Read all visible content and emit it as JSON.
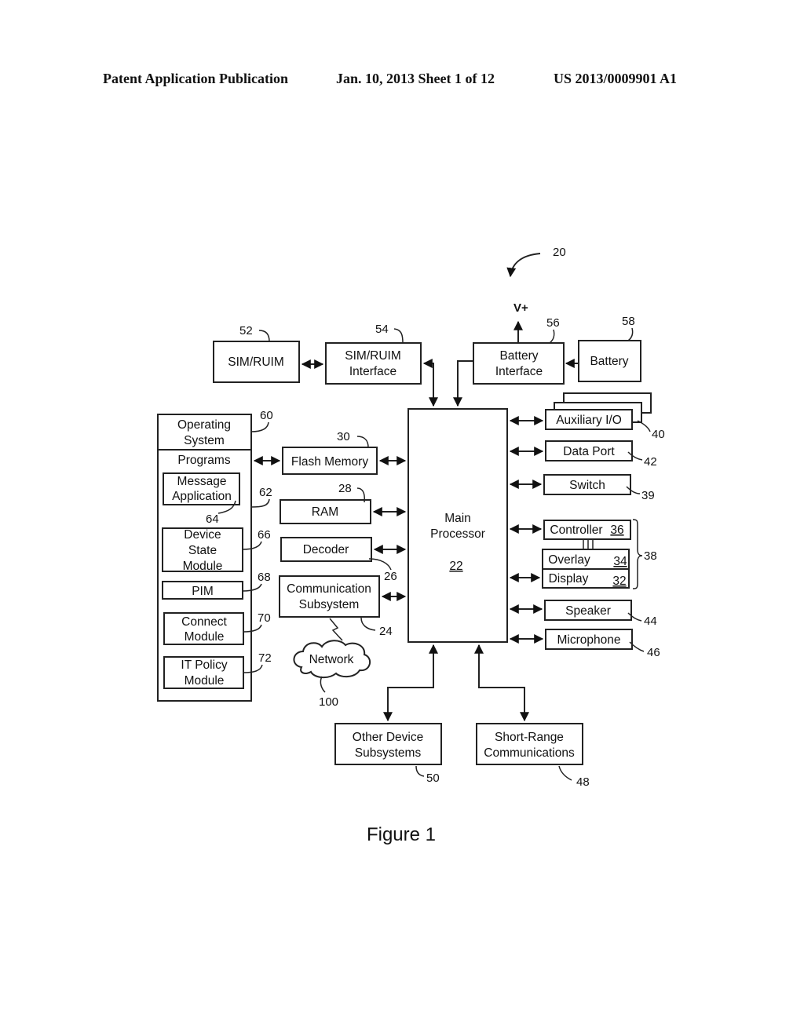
{
  "header": {
    "publication": "Patent Application Publication",
    "date_sheet": "Jan. 10, 2013  Sheet 1 of 12",
    "number": "US 2013/0009901 A1"
  },
  "diagram": {
    "device_ref": "20",
    "vplus": "V+",
    "main_processor": {
      "line1": "Main",
      "line2": "Processor",
      "ref": "22"
    },
    "sim": {
      "label": "SIM/RUIM",
      "ref": "52"
    },
    "sim_interface": {
      "line1": "SIM/RUIM",
      "line2": "Interface",
      "ref": "54"
    },
    "battery_interface": {
      "line1": "Battery",
      "line2": "Interface",
      "ref": "56"
    },
    "battery": {
      "label": "Battery",
      "ref": "58"
    },
    "os_block": {
      "os_line1": "Operating",
      "os_line2": "System",
      "ref_os": "60",
      "programs": "Programs",
      "ref_programs": "62"
    },
    "message_app": {
      "line1": "Message",
      "line2": "Application",
      "ref": "64"
    },
    "device_state": {
      "line1": "Device",
      "line2": "State",
      "line3": "Module",
      "ref": "66"
    },
    "pim": {
      "label": "PIM",
      "ref": "68"
    },
    "connect": {
      "line1": "Connect",
      "line2": "Module",
      "ref": "70"
    },
    "it_policy": {
      "line1": "IT Policy",
      "line2": "Module",
      "ref": "72"
    },
    "flash": {
      "label": "Flash Memory",
      "ref": "30"
    },
    "ram": {
      "label": "RAM",
      "ref": "28"
    },
    "decoder": {
      "label": "Decoder",
      "ref": "26"
    },
    "comm": {
      "line1": "Communication",
      "line2": "Subsystem",
      "ref": "24"
    },
    "network": {
      "label": "Network",
      "ref": "100"
    },
    "aux_io": {
      "label": "Auxiliary I/O",
      "ref": "40"
    },
    "data_port": {
      "label": "Data Port",
      "ref": "42"
    },
    "switch": {
      "label": "Switch",
      "ref": "39"
    },
    "controller": {
      "label": "Controller",
      "ref": "36"
    },
    "overlay": {
      "label": "Overlay",
      "ref": "34"
    },
    "display": {
      "label": "Display",
      "ref": "32"
    },
    "touchscreen_ref": "38",
    "speaker": {
      "label": "Speaker",
      "ref": "44"
    },
    "microphone": {
      "label": "Microphone",
      "ref": "46"
    },
    "other_device": {
      "line1": "Other Device",
      "line2": "Subsystems",
      "ref": "50"
    },
    "short_range": {
      "line1": "Short-Range",
      "line2": "Communications",
      "ref": "48"
    }
  },
  "caption": "Figure 1"
}
